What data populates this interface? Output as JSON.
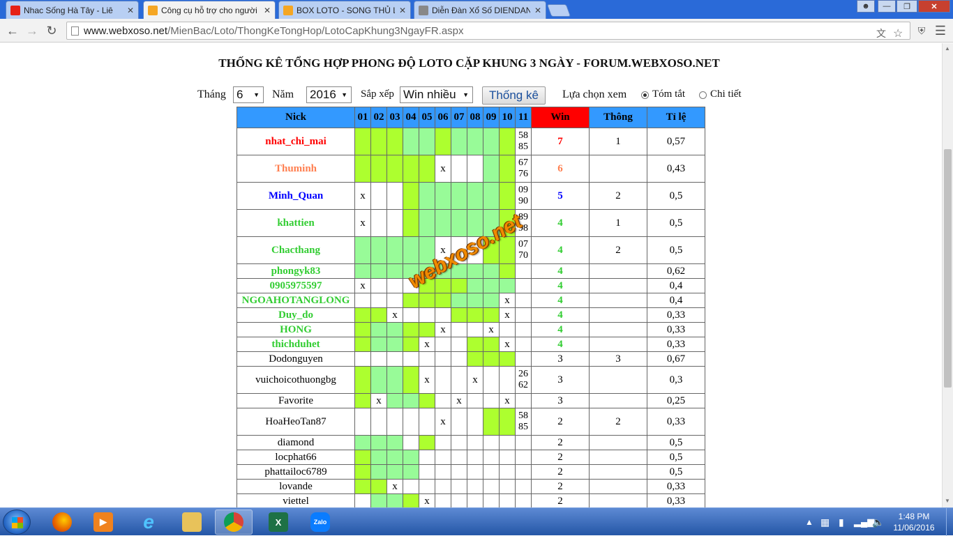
{
  "browser": {
    "tabs": [
      {
        "title": "Nhac Sống Hà Tây - Liê",
        "icon": "youtube-icon",
        "color": "#e62117"
      },
      {
        "title": "Công cụ hỗ trợ cho người",
        "icon": "xs-icon",
        "color": "#f5a623"
      },
      {
        "title": "BOX LOTO - SONG THỦ L",
        "icon": "xs-icon",
        "color": "#f5a623"
      },
      {
        "title": "Diễn Đàn Xổ Số DIENDAN",
        "icon": "page-icon",
        "color": "#888888"
      }
    ],
    "url_host": "www.webxoso.net",
    "url_path": "/MienBac/Loto/ThongKeTongHop/LotoCapKhung3NgayFR.aspx"
  },
  "page": {
    "title": "THỐNG KÊ TỔNG HỢP PHONG ĐỘ LOTO CẶP KHUNG 3 NGÀY - FORUM.WEBXOSO.NET",
    "controls": {
      "month_label": "Tháng",
      "month_value": "6",
      "year_label": "Năm",
      "year_value": "2016",
      "sort_label": "Sắp xếp",
      "sort_value": "Win nhiều",
      "submit_label": "Thống kê",
      "view_label": "Lựa chọn xem",
      "view_summary": "Tóm tắt",
      "view_detail": "Chi tiết"
    },
    "watermark": "webxoso.net"
  },
  "table": {
    "headers": {
      "nick": "Nick",
      "days": [
        "01",
        "02",
        "03",
        "04",
        "05",
        "06",
        "07",
        "08",
        "09",
        "10",
        "11"
      ],
      "win": "Win",
      "thong": "Thông",
      "tile": "Tỉ lệ"
    },
    "rows": [
      {
        "nick": "nhat_chi_mai",
        "color": "#ff0000",
        "bold": true,
        "cells": [
          "g",
          "g",
          "g",
          "l",
          "l",
          "g",
          "l",
          "l",
          "l",
          "g",
          [
            "58",
            "85"
          ]
        ],
        "win": "7",
        "thong": "1",
        "tile": "0,57"
      },
      {
        "nick": "Thuminh",
        "color": "#ff7f50",
        "bold": true,
        "cells": [
          "g",
          "g",
          "g",
          "g",
          "g",
          "x",
          "",
          "",
          "l",
          "g",
          [
            "67",
            "76"
          ]
        ],
        "win": "6",
        "thong": "",
        "tile": "0,43"
      },
      {
        "nick": "Minh_Quan",
        "color": "#0000ff",
        "bold": true,
        "cells": [
          "x",
          "",
          "",
          "g",
          "l",
          "l",
          "l",
          "l",
          "l",
          "g",
          [
            "09",
            "90"
          ]
        ],
        "win": "5",
        "thong": "2",
        "tile": "0,5"
      },
      {
        "nick": "khattien",
        "color": "#32cd32",
        "bold": true,
        "cells": [
          "x",
          "",
          "",
          "g",
          "l",
          "l",
          "l",
          "l",
          "l",
          "g",
          [
            "89",
            "98"
          ]
        ],
        "win": "4",
        "thong": "1",
        "tile": "0,5"
      },
      {
        "nick": "Chacthang",
        "color": "#32cd32",
        "bold": true,
        "cells": [
          "l",
          "l",
          "l",
          "l",
          "l",
          "x",
          "",
          "",
          "g",
          "g",
          [
            "07",
            "70"
          ]
        ],
        "win": "4",
        "thong": "2",
        "tile": "0,5"
      },
      {
        "nick": "phongyk83",
        "color": "#32cd32",
        "bold": true,
        "cells": [
          "l",
          "l",
          "l",
          "l",
          "l",
          "l",
          "l",
          "l",
          "l",
          "g",
          ""
        ],
        "win": "4",
        "thong": "",
        "tile": "0,62"
      },
      {
        "nick": "0905975597",
        "color": "#32cd32",
        "bold": true,
        "cells": [
          "x",
          "",
          "",
          "",
          "g",
          "g",
          "g",
          "l",
          "l",
          "l",
          ""
        ],
        "win": "4",
        "thong": "",
        "tile": "0,4"
      },
      {
        "nick": "NGOAHOTANGLONG",
        "color": "#32cd32",
        "bold": true,
        "cells": [
          "",
          "",
          "",
          "g",
          "g",
          "g",
          "l",
          "l",
          "l",
          "x",
          ""
        ],
        "win": "4",
        "thong": "",
        "tile": "0,4"
      },
      {
        "nick": "Duy_do",
        "color": "#32cd32",
        "bold": true,
        "cells": [
          "g",
          "g",
          "x",
          "",
          "",
          "",
          "g",
          "g",
          "g",
          "x",
          ""
        ],
        "win": "4",
        "thong": "",
        "tile": "0,33"
      },
      {
        "nick": "HONG",
        "color": "#32cd32",
        "bold": true,
        "cells": [
          "g",
          "l",
          "l",
          "g",
          "g",
          "x",
          "",
          "",
          "x",
          "",
          ""
        ],
        "win": "4",
        "thong": "",
        "tile": "0,33"
      },
      {
        "nick": "thichduhet",
        "color": "#32cd32",
        "bold": true,
        "cells": [
          "g",
          "l",
          "l",
          "g",
          "x",
          "",
          "",
          "g",
          "g",
          "x",
          ""
        ],
        "win": "4",
        "thong": "",
        "tile": "0,33"
      },
      {
        "nick": "Dodonguyen",
        "color": "#000000",
        "bold": false,
        "cells": [
          "",
          "",
          "",
          "",
          "",
          "",
          "",
          "g",
          "g",
          "g",
          ""
        ],
        "win": "3",
        "thong": "3",
        "tile": "0,67"
      },
      {
        "nick": "vuichoicothuongbg",
        "color": "#000000",
        "bold": false,
        "cells": [
          "g",
          "l",
          "l",
          "g",
          "x",
          "",
          "",
          "x",
          "",
          "",
          [
            "26",
            "62"
          ]
        ],
        "win": "3",
        "thong": "",
        "tile": "0,3"
      },
      {
        "nick": "Favorite",
        "color": "#000000",
        "bold": false,
        "cells": [
          "g",
          "x",
          "l",
          "l",
          "g",
          "",
          "x",
          "",
          "",
          "x",
          ""
        ],
        "win": "3",
        "thong": "",
        "tile": "0,25"
      },
      {
        "nick": "HoaHeoTan87",
        "color": "#000000",
        "bold": false,
        "cells": [
          "",
          "",
          "",
          "",
          "",
          "x",
          "",
          "",
          "g",
          "g",
          [
            "58",
            "85"
          ]
        ],
        "win": "2",
        "thong": "2",
        "tile": "0,33"
      },
      {
        "nick": "diamond",
        "color": "#000000",
        "bold": false,
        "cells": [
          "l",
          "l",
          "l",
          "",
          "g",
          "",
          "",
          "",
          "",
          "",
          ""
        ],
        "win": "2",
        "thong": "",
        "tile": "0,5"
      },
      {
        "nick": "locphat66",
        "color": "#000000",
        "bold": false,
        "cells": [
          "g",
          "l",
          "l",
          "l",
          "",
          "",
          "",
          "",
          "",
          "",
          ""
        ],
        "win": "2",
        "thong": "",
        "tile": "0,5"
      },
      {
        "nick": "phattailoc6789",
        "color": "#000000",
        "bold": false,
        "cells": [
          "g",
          "l",
          "l",
          "l",
          "",
          "",
          "",
          "",
          "",
          "",
          ""
        ],
        "win": "2",
        "thong": "",
        "tile": "0,5"
      },
      {
        "nick": "lovande",
        "color": "#000000",
        "bold": false,
        "cells": [
          "g",
          "g",
          "x",
          "",
          "",
          "",
          "",
          "",
          "",
          "",
          ""
        ],
        "win": "2",
        "thong": "",
        "tile": "0,33"
      },
      {
        "nick": "viettel",
        "color": "#000000",
        "bold": false,
        "cells": [
          "",
          "l",
          "l",
          "g",
          "x",
          "",
          "",
          "",
          "",
          "",
          ""
        ],
        "win": "2",
        "thong": "",
        "tile": "0,33"
      }
    ]
  },
  "taskbar": {
    "apps": [
      {
        "name": "firefox-icon",
        "color": "#e66000",
        "glyph": ""
      },
      {
        "name": "media-player-icon",
        "color": "#f0821e",
        "glyph": "▶"
      },
      {
        "name": "internet-explorer-icon",
        "color": "#1e90ff",
        "glyph": "e"
      },
      {
        "name": "file-explorer-icon",
        "color": "#e8c25a",
        "glyph": ""
      },
      {
        "name": "chrome-icon",
        "color": "#4285f4",
        "glyph": ""
      },
      {
        "name": "excel-icon",
        "color": "#1e7145",
        "glyph": "X"
      },
      {
        "name": "zalo-icon",
        "color": "#0a7cff",
        "glyph": "Zalo"
      }
    ],
    "time": "1:48 PM",
    "date": "11/06/2016"
  }
}
